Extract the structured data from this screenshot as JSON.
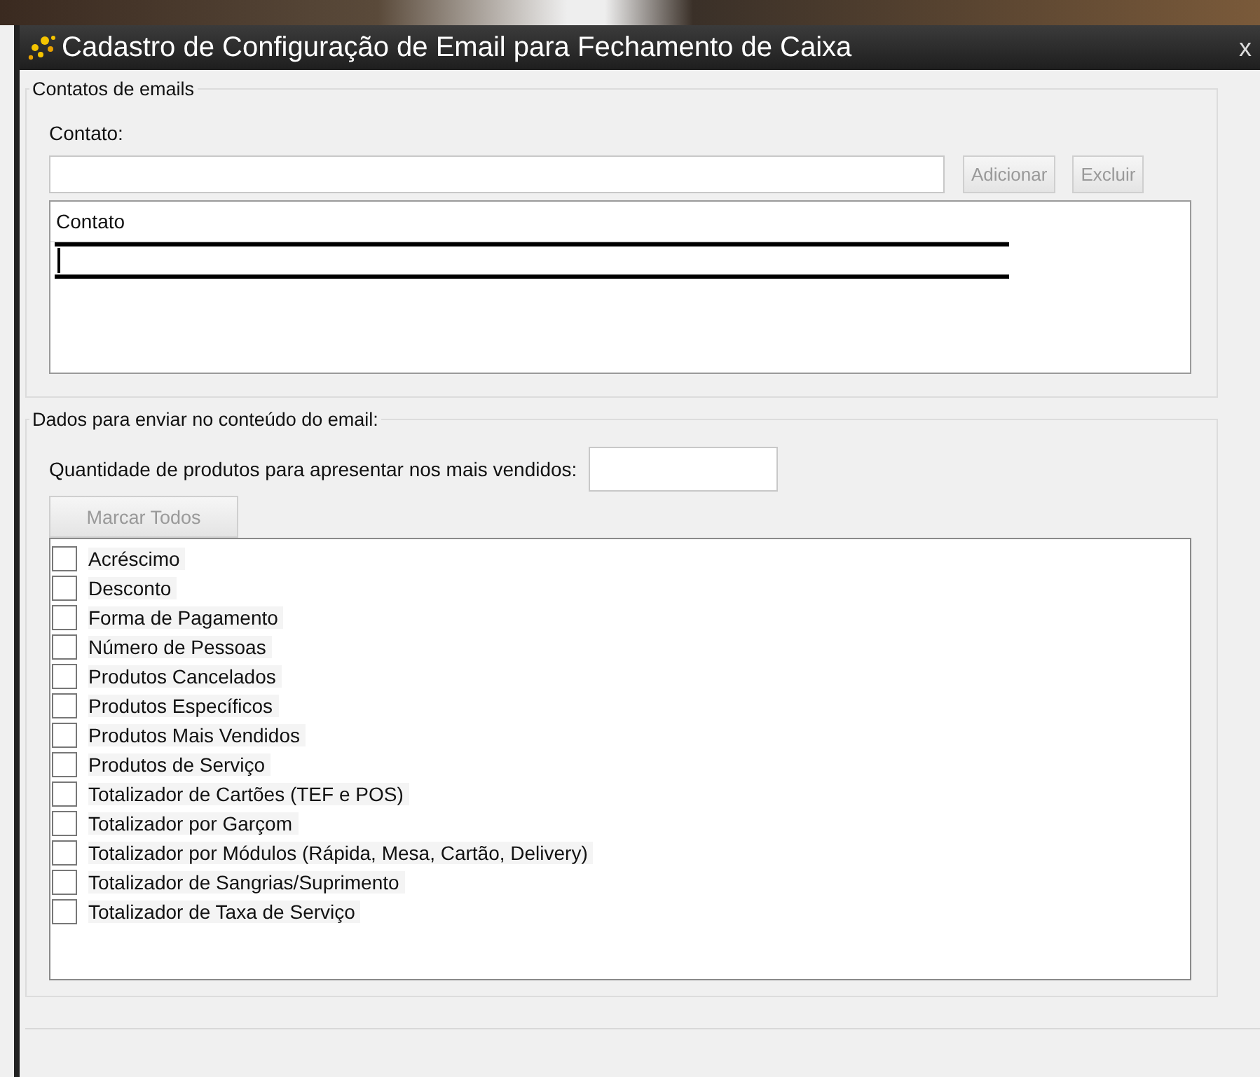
{
  "window": {
    "title": "Cadastro de Configuração de Email para Fechamento de Caixa",
    "close": "x"
  },
  "contacts": {
    "legend": "Contatos de emails",
    "label": "Contato:",
    "buttons": [
      {
        "label": "Adicionar",
        "disabled": true
      },
      {
        "label": "Excluir",
        "disabled": true
      }
    ],
    "grid": {
      "columns": [
        "Contato"
      ],
      "new_row": true
    }
  },
  "content": {
    "legend": "Dados para enviar no conteúdo do email:",
    "quantity_label": "Quantidade de produtos para apresentar nos mais vendidos:",
    "mark_all": {
      "label": "Marcar Todos",
      "disabled": true
    },
    "options": [
      {
        "label": "Acréscimo",
        "checked": false
      },
      {
        "label": "Desconto",
        "checked": false
      },
      {
        "label": "Forma de Pagamento",
        "checked": false
      },
      {
        "label": "Número de Pessoas",
        "checked": false
      },
      {
        "label": "Produtos Cancelados",
        "checked": false
      },
      {
        "label": "Produtos Específicos",
        "checked": false
      },
      {
        "label": "Produtos Mais Vendidos",
        "checked": false
      },
      {
        "label": "Produtos de Serviço",
        "checked": false
      },
      {
        "label": "Totalizador de Cartões (TEF e POS)",
        "checked": false
      },
      {
        "label": "Totalizador por Garçom",
        "checked": false
      },
      {
        "label": "Totalizador por Módulos (Rápida, Mesa, Cartão, Delivery)",
        "checked": false
      },
      {
        "label": "Totalizador de Sangrias/Suprimento",
        "checked": false
      },
      {
        "label": "Totalizador de Taxa de Serviço",
        "checked": false
      }
    ]
  }
}
